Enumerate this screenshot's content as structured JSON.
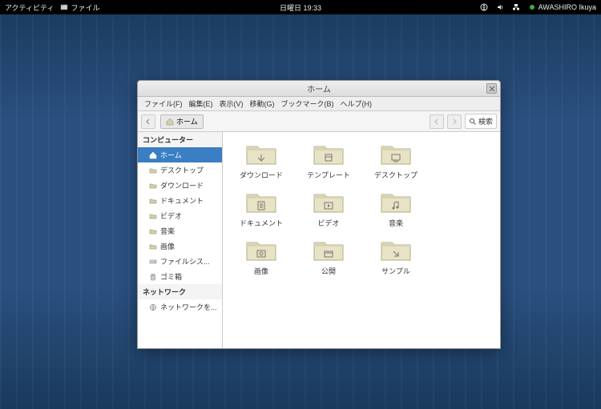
{
  "topbar": {
    "activities": "アクティビティ",
    "app_name": "ファイル",
    "clock": "日曜日 19:33",
    "username": "AWASHIRO Ikuya"
  },
  "window": {
    "title": "ホーム",
    "menubar": {
      "file": "ファイル(F)",
      "edit": "編集(E)",
      "view": "表示(V)",
      "go": "移動(G)",
      "bookmarks": "ブックマーク(B)",
      "help": "ヘルプ(H)"
    },
    "toolbar": {
      "path_label": "ホーム",
      "search_label": "検索"
    },
    "sidebar": {
      "computer_header": "コンピューター",
      "items": [
        {
          "label": "ホーム",
          "selected": true,
          "icon": "home"
        },
        {
          "label": "デスクトップ",
          "selected": false,
          "icon": "folder"
        },
        {
          "label": "ダウンロード",
          "selected": false,
          "icon": "folder"
        },
        {
          "label": "ドキュメント",
          "selected": false,
          "icon": "folder"
        },
        {
          "label": "ビデオ",
          "selected": false,
          "icon": "folder"
        },
        {
          "label": "音楽",
          "selected": false,
          "icon": "folder"
        },
        {
          "label": "画像",
          "selected": false,
          "icon": "folder"
        },
        {
          "label": "ファイルシス...",
          "selected": false,
          "icon": "drive"
        },
        {
          "label": "ゴミ箱",
          "selected": false,
          "icon": "trash"
        }
      ],
      "network_header": "ネットワーク",
      "network_items": [
        {
          "label": "ネットワークを...",
          "icon": "network"
        }
      ]
    },
    "folders": [
      {
        "label": "ダウンロード",
        "emblem": "download"
      },
      {
        "label": "テンプレート",
        "emblem": "template"
      },
      {
        "label": "デスクトップ",
        "emblem": "desktop"
      },
      {
        "label": "ドキュメント",
        "emblem": "document"
      },
      {
        "label": "ビデオ",
        "emblem": "video"
      },
      {
        "label": "音楽",
        "emblem": "music"
      },
      {
        "label": "画像",
        "emblem": "picture"
      },
      {
        "label": "公開",
        "emblem": "public"
      },
      {
        "label": "サンプル",
        "emblem": "link"
      }
    ]
  }
}
